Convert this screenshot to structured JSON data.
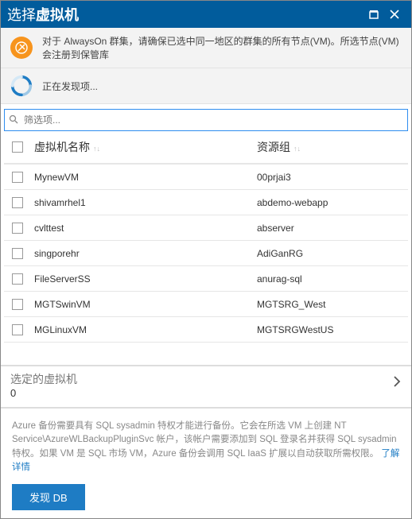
{
  "titlebar": {
    "title_prefix": "选择",
    "title_bold": "虚拟机"
  },
  "info1": "对于 AlwaysOn 群集，请确保已选中同一地区的群集的所有节点(VM)。所选节点(VM)会注册到保管库",
  "info2": "正在发现项...",
  "search": {
    "placeholder": "筛选项..."
  },
  "table": {
    "headers": {
      "name": "虚拟机名称",
      "group": "资源组"
    },
    "rows": [
      {
        "name": "MynewVM",
        "group": "00prjai3"
      },
      {
        "name": "shivamrhel1",
        "group": "abdemo-webapp"
      },
      {
        "name": "cvlttest",
        "group": "abserver"
      },
      {
        "name": "singporehr",
        "group": "AdiGanRG"
      },
      {
        "name": "FileServerSS",
        "group": "anurag-sql"
      },
      {
        "name": "MGTSwinVM",
        "group": "MGTSRG_West"
      },
      {
        "name": "MGLinuxVM",
        "group": "MGTSRGWestUS"
      }
    ]
  },
  "selected": {
    "label": "选定的虚拟机",
    "count": "0"
  },
  "footer": {
    "note_plain1": "Azure 备份需要具有 SQL sysadmin 特权才能进行备份。它会在所选 VM 上创建 NT Service\\AzureWLBackupPluginSvc 帐户，该帐户需要添加到 SQL 登录名并获得 SQL sysadmin 特权。如果 VM 是 SQL 市场 VM，Azure 备份会调用 SQL IaaS 扩展以自动获取所需权限。",
    "note_link": "了解详情",
    "button": "发现 DB"
  }
}
